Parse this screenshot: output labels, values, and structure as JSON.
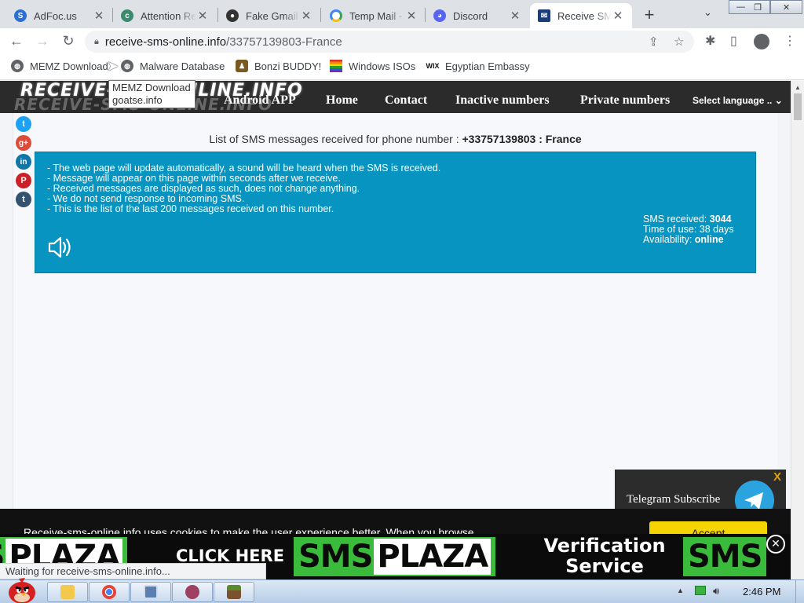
{
  "browser": {
    "tabs": [
      {
        "title": "AdFoc.us",
        "icon": "adfocus-icon",
        "color": "#2b6fd6",
        "active": false
      },
      {
        "title": "Attention Re",
        "icon": "cloudflare-icon",
        "color": "#3b8a6e",
        "active": false
      },
      {
        "title": "Fake Gmail",
        "icon": "person-icon",
        "color": "#333333",
        "active": false
      },
      {
        "title": "Temp Mail -",
        "icon": "google-icon",
        "color": "#4285f4",
        "active": false
      },
      {
        "title": "Discord",
        "icon": "discord-icon",
        "color": "#5865f2",
        "active": false
      },
      {
        "title": "Receive SM",
        "icon": "envelope-icon",
        "color": "#1a3d7c",
        "active": true
      }
    ],
    "new_tab": "+",
    "address": {
      "host": "receive-sms-online.info",
      "path": "/33757139803-France"
    },
    "bookmarks": [
      {
        "label": "MEMZ Download",
        "icon": "globe-icon",
        "color": "#5f6368"
      },
      {
        "label": "Malware Database",
        "icon": "globe-icon",
        "color": "#5f6368"
      },
      {
        "label": "Bonzi BUDDY!",
        "icon": "bonzi-icon",
        "color": "#7a5a1e"
      },
      {
        "label": "Windows ISOs",
        "icon": "rainbow-flag-icon",
        "color": "#e03030"
      },
      {
        "label": "Egyptian Embassy",
        "icon": "wix-icon",
        "color": "#111111"
      }
    ],
    "tooltip": {
      "line1": "MEMZ Download",
      "line2": "goatse.info"
    },
    "status": "Waiting for receive-sms-online.info..."
  },
  "site": {
    "logo": "RECEIVE-SMS-ONLINE.INFO",
    "nav": [
      "Android APP",
      "Home",
      "Contact",
      "Inactive numbers",
      "Private numbers"
    ],
    "language": "Select language ..",
    "heading_prefix": "List of SMS messages received for phone number : ",
    "heading_number": "+33757139803 : France",
    "notes": [
      "- The web page will update automatically, a sound will be heard when the SMS is received.",
      "- Message will appear on this page within seconds after we receive.",
      "- Received messages are displayed as such, does not change anything.",
      "- We do not send response to incoming SMS.",
      "- This is the list of the last 200 messages received on this number."
    ],
    "stats": {
      "sms_label": "SMS received: ",
      "sms_value": "3044",
      "time_label": "Time of use: 38 days",
      "avail_label": "Availability: ",
      "avail_value": "online"
    },
    "share_icons": [
      {
        "name": "twitter-icon",
        "color": "#1da1f2",
        "glyph": "t"
      },
      {
        "name": "google-plus-icon",
        "color": "#dd4b39",
        "glyph": "g+"
      },
      {
        "name": "linkedin-icon",
        "color": "#0e76a8",
        "glyph": "in"
      },
      {
        "name": "pinterest-icon",
        "color": "#cb2027",
        "glyph": "P"
      },
      {
        "name": "tumblr-icon",
        "color": "#34526f",
        "glyph": "t"
      }
    ]
  },
  "overlays": {
    "telegram_text": "Telegram Subscribe",
    "telegram_close": "X",
    "cookie_text": "Receive-sms-online.info uses cookies to make the user experience better. When you browse",
    "accept": "Accept",
    "ad": {
      "sms": "SMS",
      "plaza": "PLAZA",
      "click": "CLICK HERE",
      "verify_1": "Verification",
      "verify_2": "Service"
    },
    "ad_close": "✕"
  },
  "taskbar": {
    "clock": "2:46 PM"
  },
  "colors": {
    "info_box": "#0894c0",
    "accept": "#f5d400",
    "ad_green": "#3bbb3b"
  }
}
